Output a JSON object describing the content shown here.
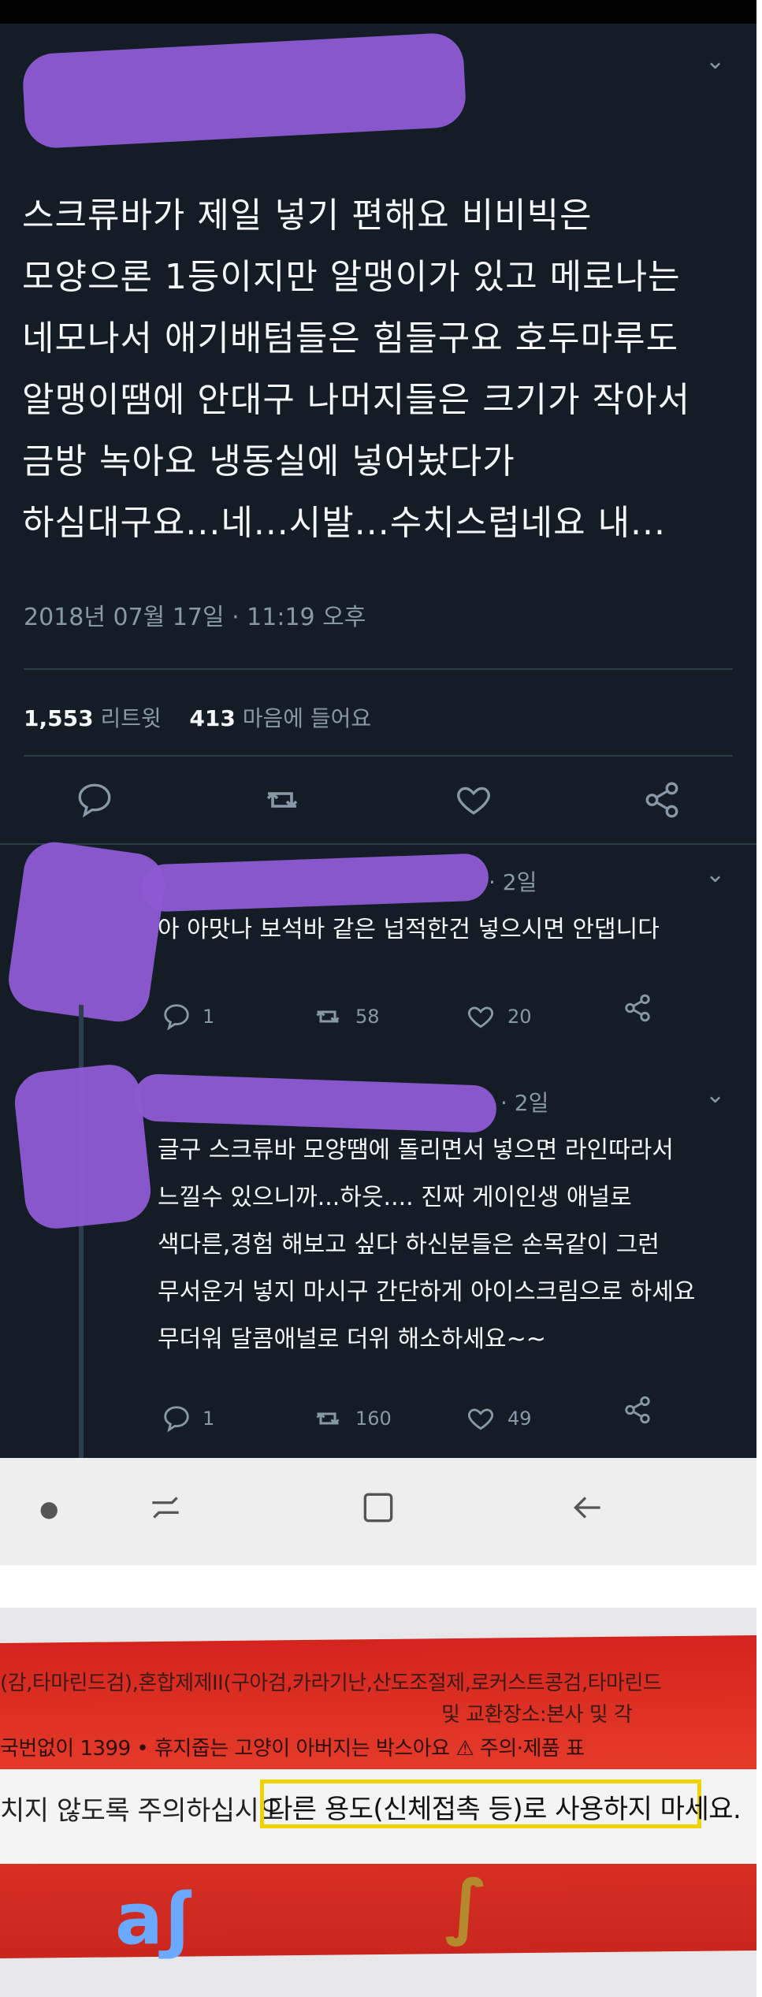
{
  "tweet": {
    "text": "스크류바가 제일 넣기 편해요 비비빅은\n모양으론 1등이지만 알맹이가 있고 메로나는\n네모나서 애기배텀들은 힘들구요 호두마루도\n알맹이땜에 안대구 나머지들은 크기가 작아서\n금방 녹아요 냉동실에 넣어놨다가\n하심대구요...네...시발...수치스럽네요 내...",
    "timestamp": "2018년 07월 17일 · 11:19 오후",
    "retweet_count": "1,553",
    "retweet_label": "리트윗",
    "like_count": "413",
    "like_label": "마음에 들어요"
  },
  "replies": [
    {
      "time": "· 2일",
      "text": "아 아맛나 보석바 같은 넙적한건 넣으시면 안댑니다",
      "reply_count": "1",
      "retweet_count": "58",
      "like_count": "20"
    },
    {
      "time": "· 2일",
      "text": "글구 스크류바 모양땜에 돌리면서 넣으면 라인따라서\n느낄수 있으니까...하읏.... 진짜 게이인생 애널로\n색다른,경험 해보고 싶다 하신분들은 손목같이 그런\n무서운거 넣지 마시구 간단하게 아이스크림으로 하세요\n무더워 달콤애널로 더위 해소하세요~~",
      "reply_count": "1",
      "retweet_count": "160",
      "like_count": "49"
    }
  ],
  "icons": {
    "reply": "reply-icon",
    "retweet": "retweet-icon",
    "like": "heart-icon",
    "share": "share-icon",
    "chevron": "chevron-down-icon"
  },
  "photo": {
    "line1": "(감,타마린드검),혼합제제II(구아검,카라기난,산도조절제,로커스트콩검,타마린드",
    "line2": "국번없이 1399 • 휴지줍는 고양이 아버지는 박스아요 ⚠ 주의·제품 표",
    "warning_prefix": "치지 않도록 주의하십시오",
    "highlighted": "다른 용도(신체접촉 등)로 사용하지 마세요.",
    "line_top": "및 교환장소:본사 및 각",
    "highlight_color": "#f0d200"
  },
  "colors": {
    "background": "#141d26",
    "text": "#f5f8fa",
    "muted": "#8899a6",
    "redaction": "#8e5bd4"
  }
}
